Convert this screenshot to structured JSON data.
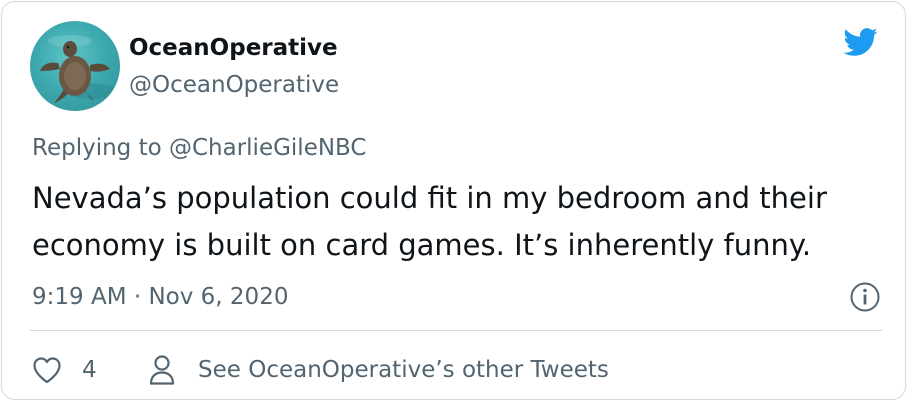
{
  "author": {
    "display_name": "OceanOperative",
    "handle": "@OceanOperative"
  },
  "reply_to": "Replying to @CharlieGileNBC",
  "tweet": {
    "lines": [
      "Nevada’s population could fit in my bedroom and their",
      "economy is built on card games. It’s inherently funny."
    ],
    "timestamp": "9:19 AM · Nov 6, 2020"
  },
  "actions": {
    "like_count": "4",
    "other_tweets_label": "See OceanOperative’s other Tweets"
  },
  "icons": {
    "logo": "twitter-bird-icon",
    "info": "info-icon",
    "like": "heart-icon",
    "profile": "person-icon"
  },
  "colors": {
    "brand_blue": "#1d9bf0",
    "secondary_text": "#536471",
    "primary_text": "#0f1419",
    "border": "#cfd9de"
  }
}
